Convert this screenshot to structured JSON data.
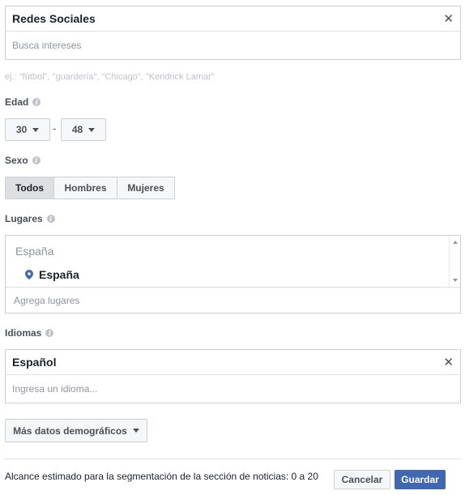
{
  "interests": {
    "selected": "Redes Sociales",
    "placeholder": "Busca intereses",
    "hint": "ej.: \"fútbol\", \"guardería\", \"Chicago\", \"Kendrick Lamar\""
  },
  "age": {
    "label": "Edad",
    "min": "30",
    "separator": "-",
    "max": "48"
  },
  "gender": {
    "label": "Sexo",
    "options": [
      "Todos",
      "Hombres",
      "Mujeres"
    ],
    "selected": "Todos"
  },
  "locations": {
    "label": "Lugares",
    "group": "España",
    "item": "España",
    "placeholder": "Agrega lugares"
  },
  "languages": {
    "label": "Idiomas",
    "selected": "Español",
    "placeholder": "Ingresa un idioma..."
  },
  "more_demographics": {
    "label": "Más datos demográficos"
  },
  "footer": {
    "reach_text": "Alcance estimado para la segmentación de la sección de noticias: 0 a 20",
    "cancel_label": "Cancelar",
    "save_label": "Guardar"
  },
  "icons": {
    "close": "close-icon",
    "info": "info-icon",
    "location_pin": "location-pin-icon",
    "dropdown": "chevron-down-icon"
  },
  "colors": {
    "primary": "#4267b2",
    "border": "#ccd0d5",
    "location_pin": "#4267b2"
  }
}
